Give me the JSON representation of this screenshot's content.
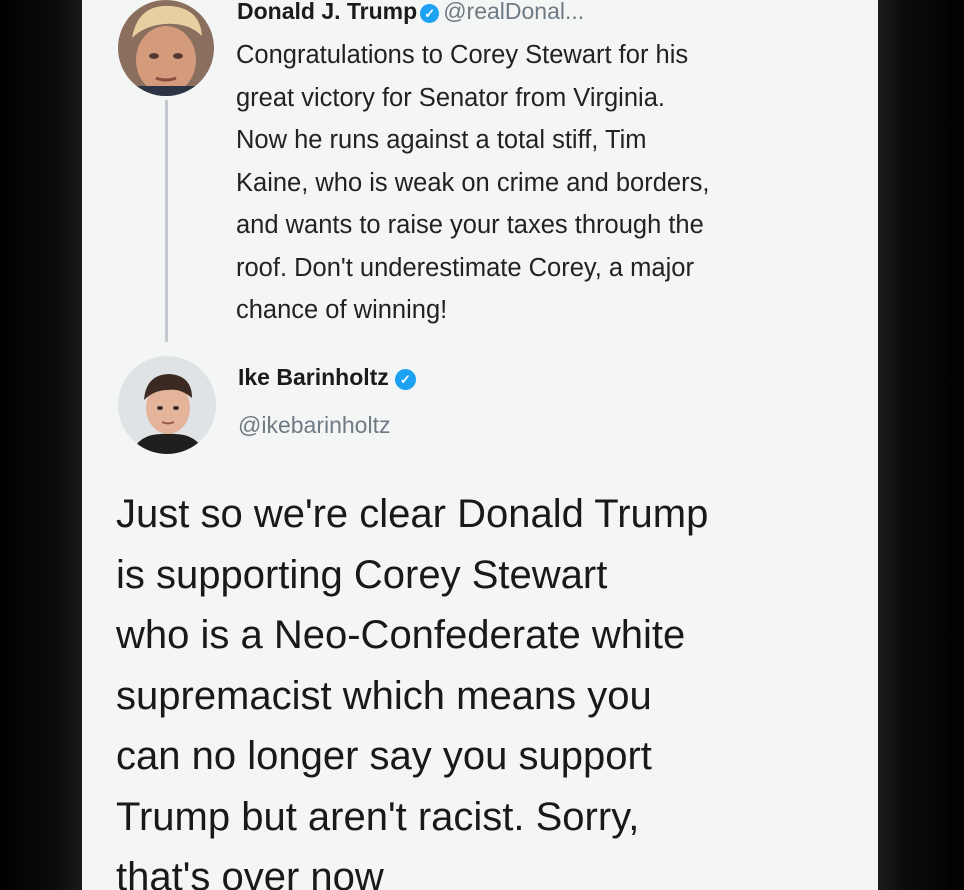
{
  "tweet_original": {
    "author_name": "Donald J. Trump",
    "author_handle": "@realDonal...",
    "verified_icon": "verified-badge-icon",
    "lines": [
      "Congratulations to Corey Stewart for his",
      "great victory for Senator from Virginia.",
      "Now he runs against a total stiff, Tim",
      "Kaine, who is weak on crime and borders,",
      "and wants to raise your taxes through the",
      "roof. Don't underestimate Corey, a major",
      "chance of winning!"
    ]
  },
  "tweet_reply": {
    "author_name": "Ike Barinholtz",
    "author_handle": "@ikebarinholtz",
    "verified_icon": "verified-badge-icon",
    "lines": [
      "Just so we're clear Donald Trump",
      "is supporting Corey Stewart",
      "who is a Neo-Confederate white",
      "supremacist which means you",
      "can no longer say you support",
      "Trump but aren't racist. Sorry,",
      "that's over now"
    ]
  },
  "colors": {
    "verified": "#1da1f2",
    "handle": "#6e7a84",
    "background": "#f4f5f5",
    "frame": "#0b0b0c"
  }
}
